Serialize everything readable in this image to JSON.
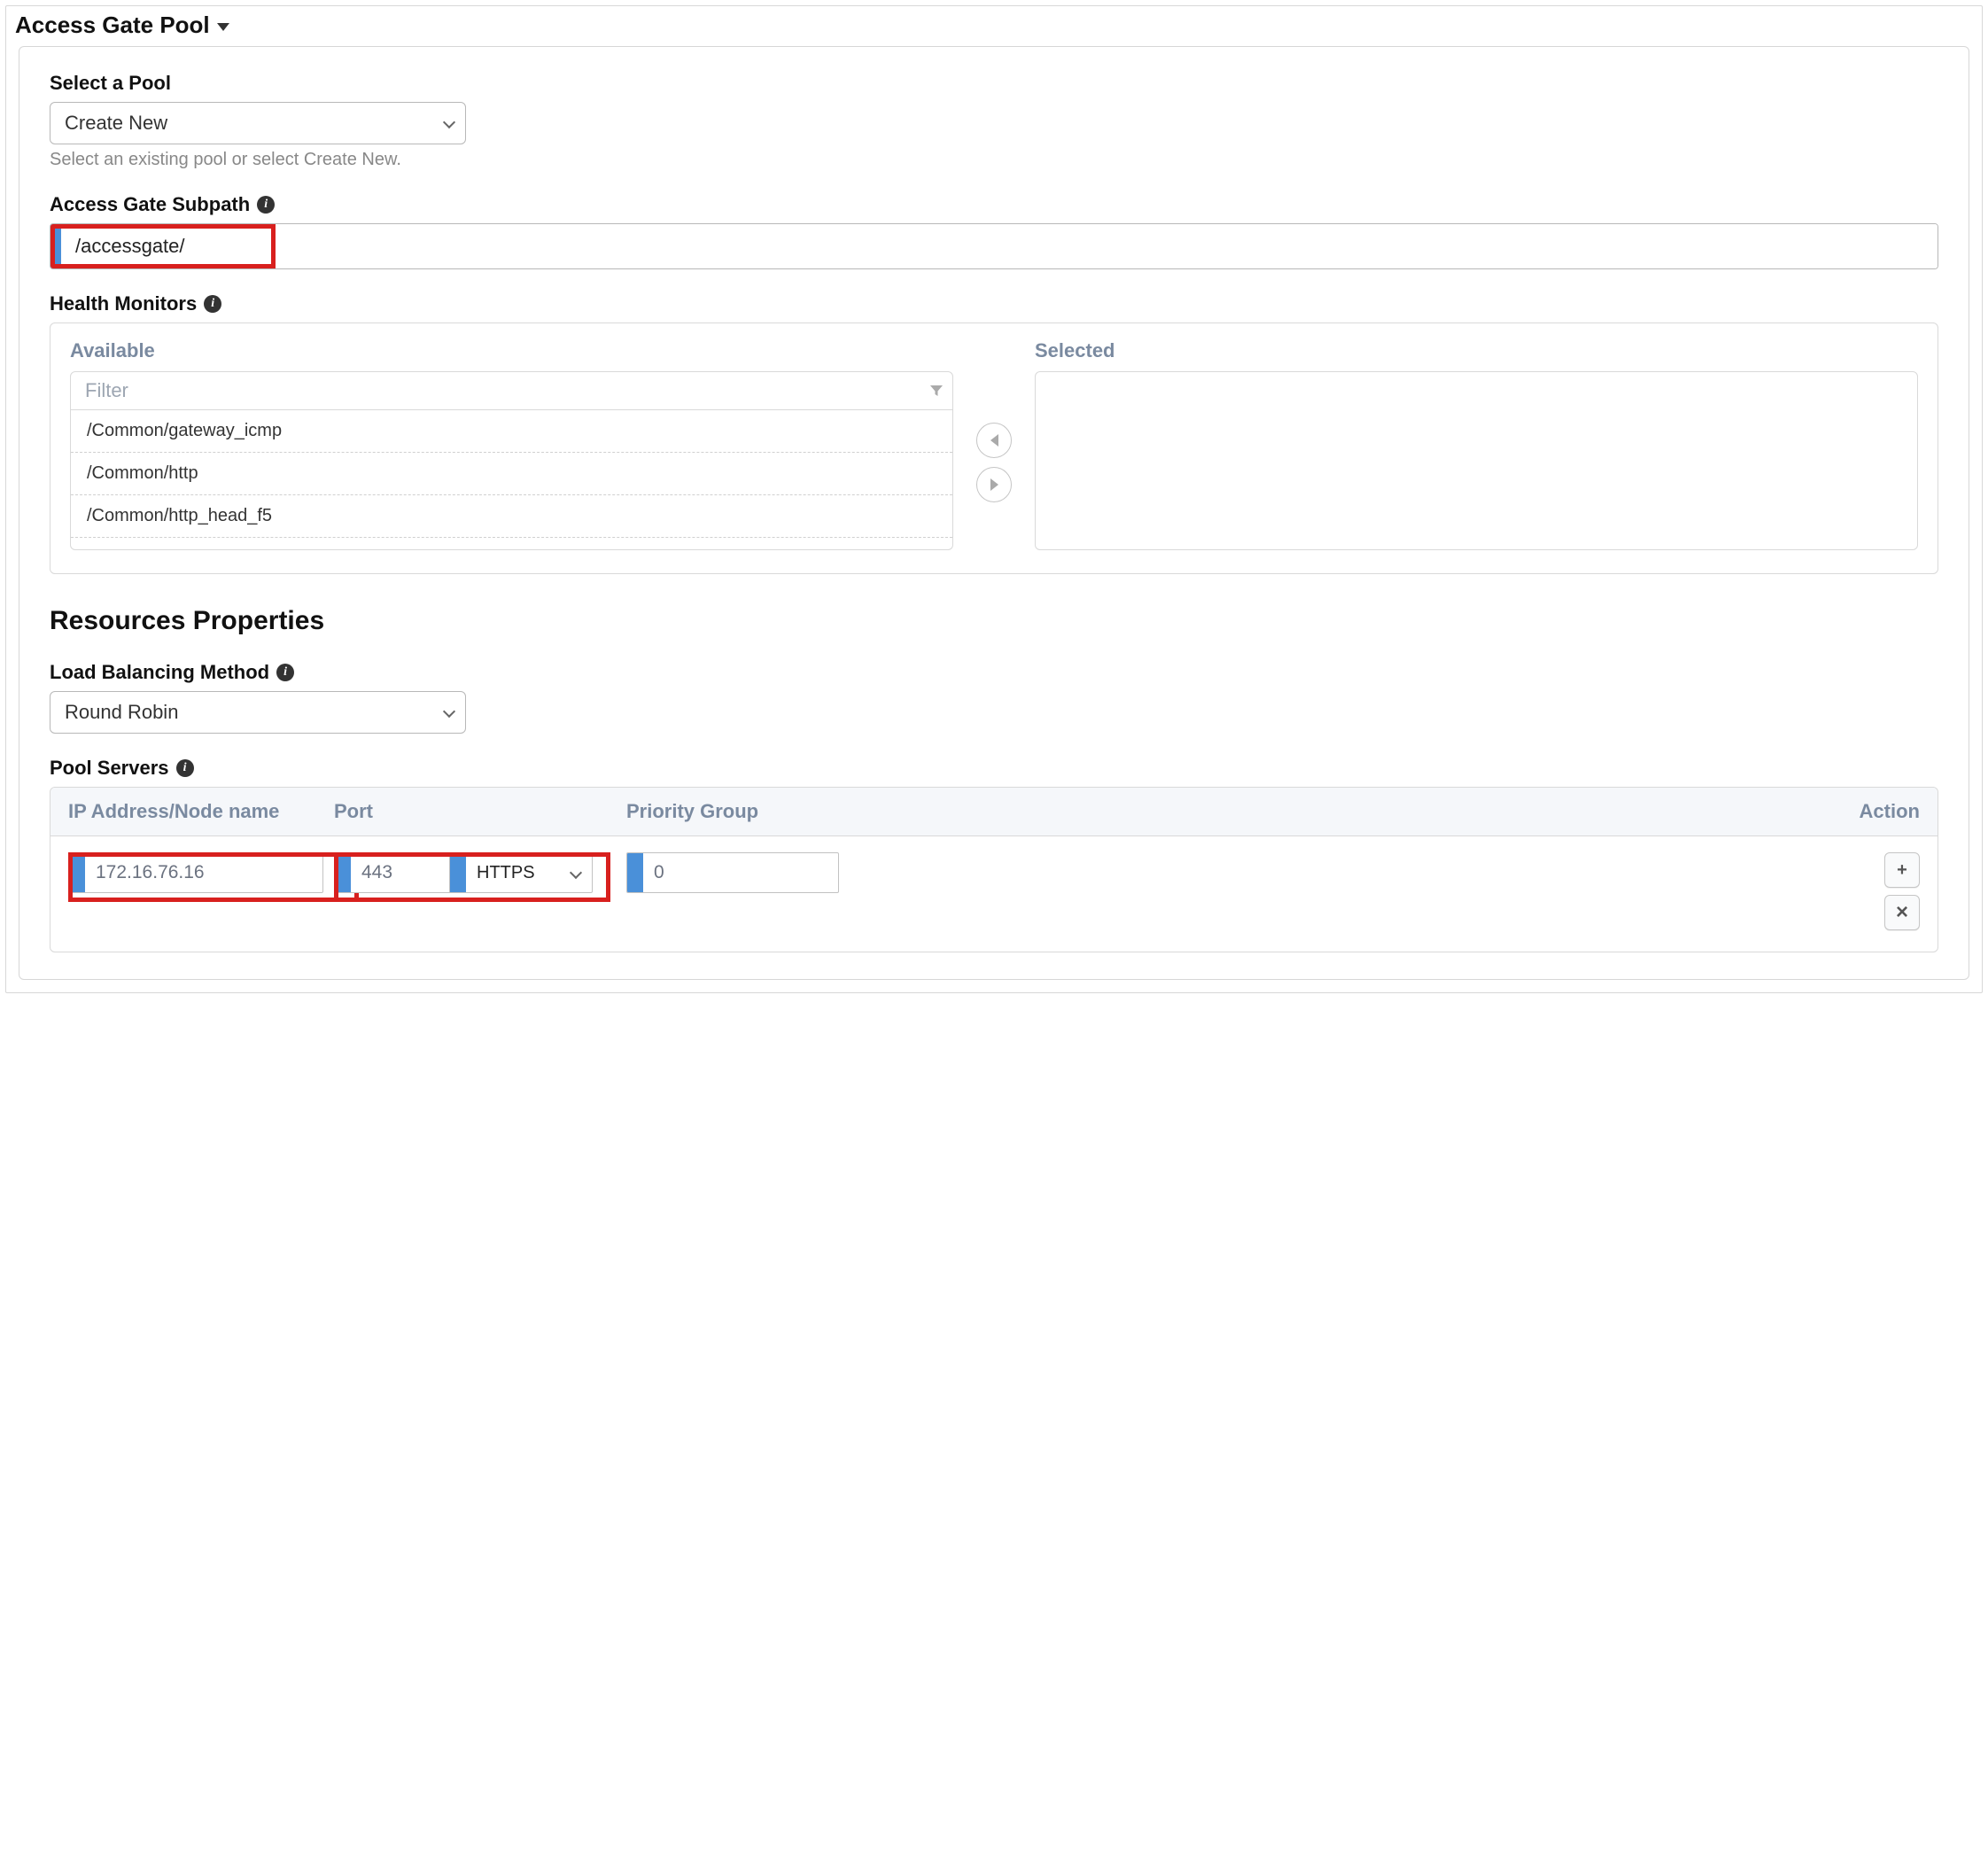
{
  "section_title": "Access Gate Pool",
  "pool": {
    "label": "Select a Pool",
    "value": "Create New",
    "help": "Select an existing pool or select Create New."
  },
  "subpath": {
    "label": "Access Gate Subpath",
    "value": "/accessgate/"
  },
  "health_monitors": {
    "label": "Health Monitors",
    "available_label": "Available",
    "selected_label": "Selected",
    "filter_placeholder": "Filter",
    "available": [
      "/Common/gateway_icmp",
      "/Common/http",
      "/Common/http_head_f5"
    ]
  },
  "resources_heading": "Resources Properties",
  "lb": {
    "label": "Load Balancing Method",
    "value": "Round Robin"
  },
  "pool_servers": {
    "label": "Pool Servers",
    "columns": {
      "ip": "IP Address/Node name",
      "port": "Port",
      "prio": "Priority Group",
      "action": "Action"
    },
    "row": {
      "ip": "172.16.76.16",
      "port": "443",
      "protocol": "HTTPS",
      "priority": "0"
    }
  }
}
